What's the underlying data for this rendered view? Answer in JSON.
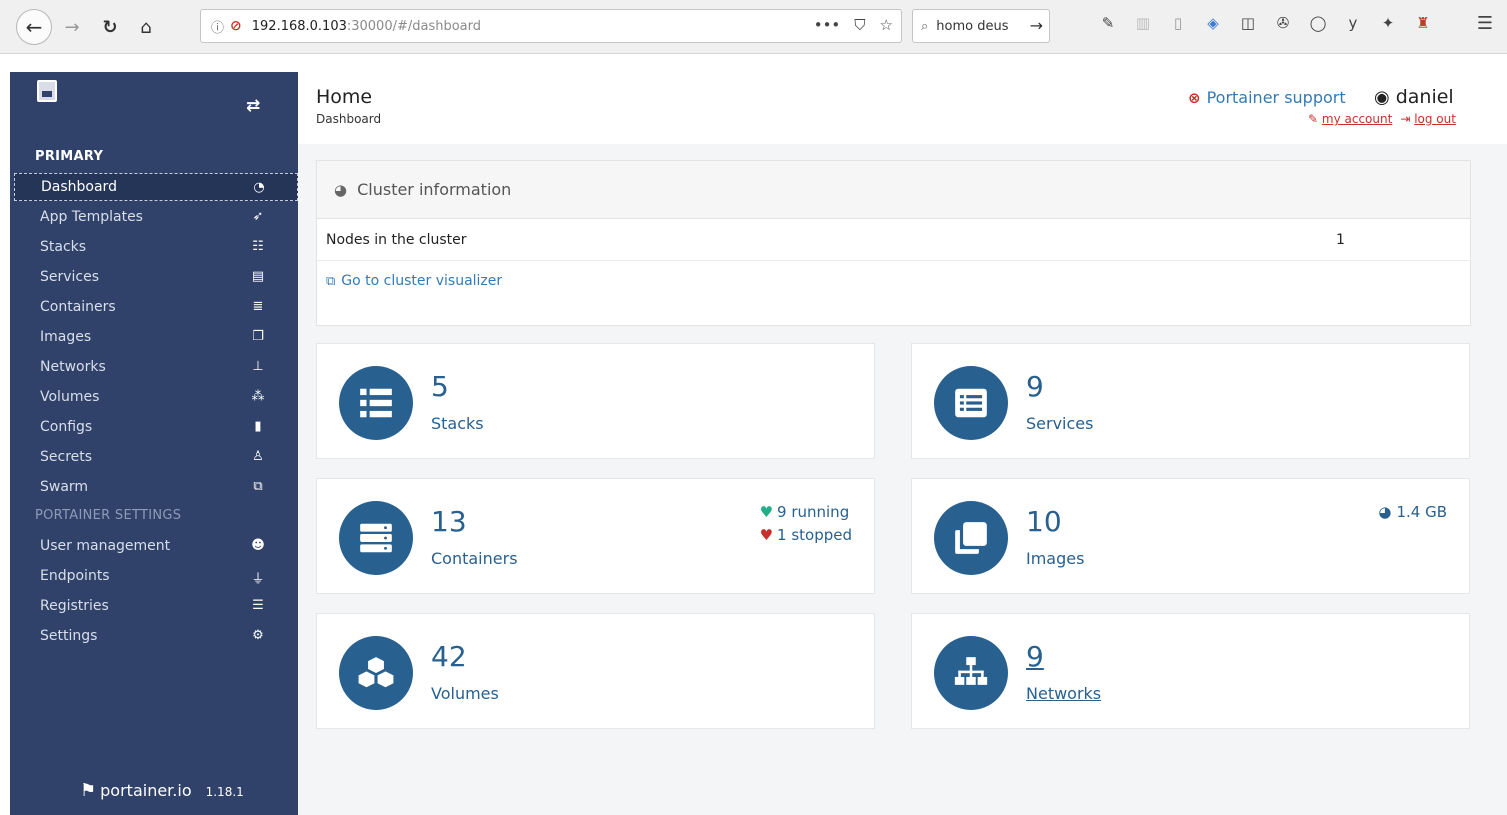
{
  "browser": {
    "url_host": "192.168.0.103",
    "url_path": ":30000/#/dashboard",
    "search_text": "homo deus"
  },
  "sidebar": {
    "primary_title": "PRIMARY",
    "settings_title": "PORTAINER SETTINGS",
    "primary_items": [
      {
        "label": "Dashboard",
        "icon": "dashboard-icon"
      },
      {
        "label": "App Templates",
        "icon": "rocket-icon"
      },
      {
        "label": "Stacks",
        "icon": "list-icon"
      },
      {
        "label": "Services",
        "icon": "list-alt-icon"
      },
      {
        "label": "Containers",
        "icon": "server-icon"
      },
      {
        "label": "Images",
        "icon": "clone-icon"
      },
      {
        "label": "Networks",
        "icon": "sitemap-icon"
      },
      {
        "label": "Volumes",
        "icon": "cubes-icon"
      },
      {
        "label": "Configs",
        "icon": "file-icon"
      },
      {
        "label": "Secrets",
        "icon": "user-secret-icon"
      },
      {
        "label": "Swarm",
        "icon": "object-group-icon"
      }
    ],
    "settings_items": [
      {
        "label": "User management",
        "icon": "users-icon"
      },
      {
        "label": "Endpoints",
        "icon": "plug-icon"
      },
      {
        "label": "Registries",
        "icon": "database-icon"
      },
      {
        "label": "Settings",
        "icon": "cogs-icon"
      }
    ],
    "footer_brand": "portainer.io",
    "footer_version": "1.18.1"
  },
  "header": {
    "title": "Home",
    "breadcrumb": "Dashboard",
    "support_label": "Portainer support",
    "username": "daniel",
    "my_account_label": "my account",
    "log_out_label": "log out"
  },
  "cluster": {
    "title": "Cluster information",
    "nodes_label": "Nodes in the cluster",
    "nodes_count": "1",
    "visualizer_link": "Go to cluster visualizer"
  },
  "stats": {
    "stacks": {
      "value": "5",
      "label": "Stacks"
    },
    "services": {
      "value": "9",
      "label": "Services"
    },
    "containers": {
      "value": "13",
      "label": "Containers",
      "running": "9 running",
      "stopped": "1 stopped"
    },
    "images": {
      "value": "10",
      "label": "Images",
      "size": "1.4 GB"
    },
    "volumes": {
      "value": "42",
      "label": "Volumes"
    },
    "networks": {
      "value": "9",
      "label": "Networks"
    }
  },
  "colors": {
    "sidebar_bg": "#30426a",
    "accent": "#286090",
    "link": "#337ab7",
    "danger": "#c9302c",
    "success": "#23ae89"
  }
}
